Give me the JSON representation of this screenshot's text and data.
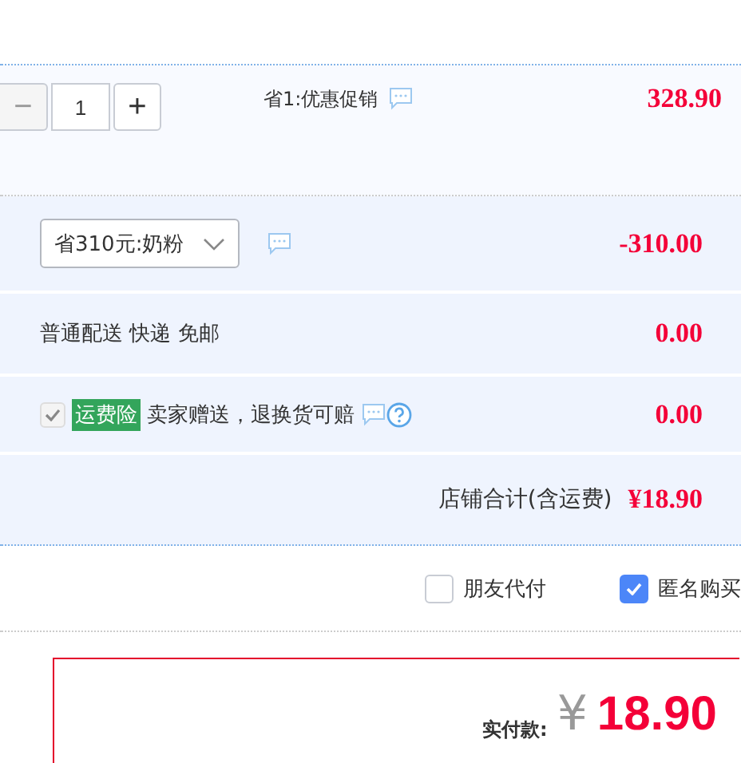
{
  "item": {
    "stepper": {
      "minus_disabled": true,
      "quantity": "1",
      "plus": "+",
      "minus": "−"
    },
    "promotion": "省1:优惠促销",
    "price": "328.90"
  },
  "discount": {
    "select": "省310元:奶粉",
    "amount": "-310.00"
  },
  "shipping": {
    "label": "普通配送 快递 免邮",
    "amount": "0.00"
  },
  "insurance": {
    "checked": true,
    "disabled": true,
    "badge": "运费险",
    "text": "卖家赠送，退换货可赔",
    "amount": "0.00"
  },
  "shop_total": {
    "label": "店铺合计(含运费)",
    "amount": "¥18.90"
  },
  "options": [
    {
      "label": "朋友代付",
      "checked": false
    },
    {
      "label": "匿名购买",
      "checked": true
    }
  ],
  "payment": {
    "label": "实付款:",
    "currency": "¥",
    "amount": "18.90"
  }
}
